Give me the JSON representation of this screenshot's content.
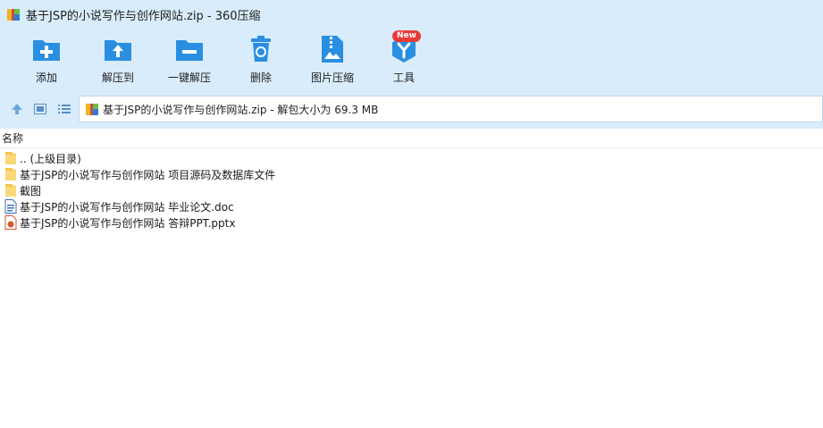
{
  "window": {
    "title": "基于JSP的小说写作与创作网站.zip - 360压缩",
    "app_icon": "zip-archive-icon"
  },
  "toolbar": {
    "items": [
      {
        "label": "添加",
        "icon": "add-icon"
      },
      {
        "label": "解压到",
        "icon": "extract-to-icon"
      },
      {
        "label": "一键解压",
        "icon": "one-click-extract-icon"
      },
      {
        "label": "删除",
        "icon": "trash-icon"
      },
      {
        "label": "图片压缩",
        "icon": "image-compress-icon"
      },
      {
        "label": "工具",
        "icon": "tools-icon",
        "badge": "New"
      }
    ]
  },
  "address": {
    "text": "基于JSP的小说写作与创作网站.zip - 解包大小为 69.3 MB"
  },
  "list": {
    "column_name": "名称",
    "rows": [
      {
        "name": ".. (上级目录)",
        "type": "folder"
      },
      {
        "name": "基于JSP的小说写作与创作网站 项目源码及数据库文件",
        "type": "folder"
      },
      {
        "name": "截图",
        "type": "folder"
      },
      {
        "name": "基于JSP的小说写作与创作网站 毕业论文.doc",
        "type": "doc"
      },
      {
        "name": "基于JSP的小说写作与创作网站 答辩PPT.pptx",
        "type": "pptx"
      }
    ]
  },
  "colors": {
    "toolbar_bg": "#d9ecfb",
    "icon_blue": "#2a8fe0",
    "badge_red": "#e8393a"
  }
}
